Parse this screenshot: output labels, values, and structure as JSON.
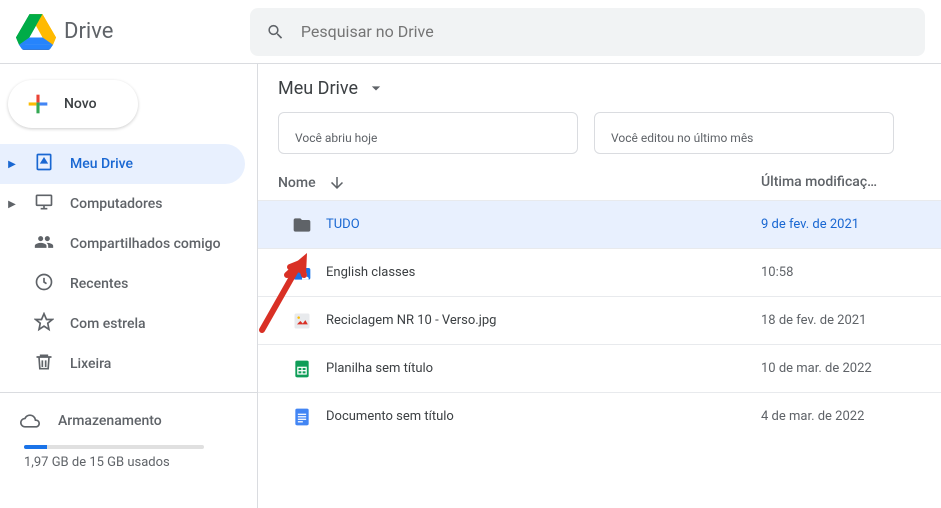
{
  "header": {
    "app_name": "Drive",
    "search_placeholder": "Pesquisar no Drive"
  },
  "sidebar": {
    "new_label": "Novo",
    "items": [
      {
        "label": "Meu Drive",
        "icon": "drive-icon",
        "expandable": true,
        "active": true
      },
      {
        "label": "Computadores",
        "icon": "computer-icon",
        "expandable": true,
        "active": false
      },
      {
        "label": "Compartilhados comigo",
        "icon": "shared-icon",
        "expandable": false,
        "active": false
      },
      {
        "label": "Recentes",
        "icon": "clock-icon",
        "expandable": false,
        "active": false
      },
      {
        "label": "Com estrela",
        "icon": "star-icon",
        "expandable": false,
        "active": false
      },
      {
        "label": "Lixeira",
        "icon": "trash-icon",
        "expandable": false,
        "active": false
      }
    ],
    "storage": {
      "label": "Armazenamento",
      "usage_text": "1,97 GB de 15 GB usados",
      "percent": 13
    }
  },
  "main": {
    "breadcrumb": "Meu Drive",
    "suggest": [
      {
        "text": "Você abriu hoje"
      },
      {
        "text": "Você editou no último mês"
      }
    ],
    "columns": {
      "name": "Nome",
      "modified": "Última modificaç…"
    },
    "rows": [
      {
        "name": "TUDO",
        "date": "9 de fev. de 2021",
        "icon": "folder-dark",
        "selected": true
      },
      {
        "name": "English classes",
        "date": "10:58",
        "icon": "folder-blue",
        "selected": false
      },
      {
        "name": "Reciclagem NR 10 - Verso.jpg",
        "date": "18 de fev. de 2021",
        "icon": "image",
        "selected": false
      },
      {
        "name": "Planilha sem título",
        "date": "10 de mar. de 2022",
        "icon": "sheet",
        "selected": false
      },
      {
        "name": "Documento sem título",
        "date": "4 de mar. de 2022",
        "icon": "doc",
        "selected": false
      }
    ]
  }
}
